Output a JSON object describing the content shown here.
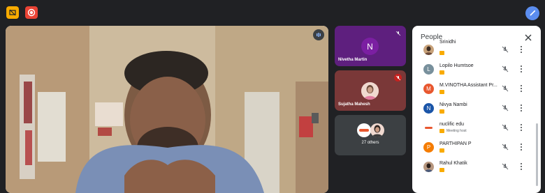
{
  "colors": {
    "accent": "#8ab4f8",
    "present": "#f9ab00",
    "record": "#ea4335"
  },
  "topbar": {
    "present_icon": "present-icon",
    "record_icon": "record-icon",
    "annotate_icon": "pen-icon"
  },
  "main": {
    "speaking_icon": "audio-level-icon"
  },
  "tiles": [
    {
      "name": "Nivetha Martin",
      "initial": "N",
      "muted": true
    },
    {
      "name": "Sujatha Mahesh",
      "muted": true
    },
    {
      "label": "27 others"
    }
  ],
  "panel": {
    "title": "People",
    "people": [
      {
        "name": "Srinidhi",
        "initial": "",
        "type": "photo"
      },
      {
        "name": "Lopilo Humtsoe",
        "initial": "L",
        "color": "#78909c"
      },
      {
        "name": "M.VINOTHA Assistant Pr...",
        "initial": "M",
        "color": "#e8572f"
      },
      {
        "name": "Nivya Nambi",
        "initial": "N",
        "color": "#1a55a8"
      },
      {
        "name": "nuclific edu",
        "initial": "",
        "color": "#ffffff",
        "sub": "Meeting host"
      },
      {
        "name": "PARTHIPAN P",
        "initial": "P",
        "color": "#f57c00"
      },
      {
        "name": "Rahul Khatik",
        "initial": "",
        "type": "photo"
      }
    ]
  }
}
